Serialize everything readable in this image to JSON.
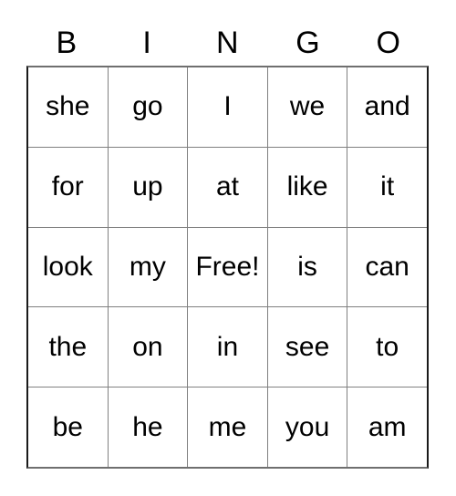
{
  "card": {
    "title": "BINGO",
    "headers": [
      "B",
      "I",
      "N",
      "G",
      "O"
    ],
    "free_space_label": "Free!",
    "free_space_position": {
      "row": 2,
      "col": 2
    },
    "grid": [
      [
        "she",
        "go",
        "I",
        "we",
        "and"
      ],
      [
        "for",
        "up",
        "at",
        "like",
        "it"
      ],
      [
        "look",
        "my",
        "Free!",
        "is",
        "can"
      ],
      [
        "the",
        "on",
        "in",
        "see",
        "to"
      ],
      [
        "be",
        "he",
        "me",
        "you",
        "am"
      ]
    ],
    "colors": {
      "text": "#000000",
      "cell_background": "#ffffff",
      "inner_border": "#808080",
      "outer_border": "#1a1a1a",
      "page_background": "#ffffff"
    }
  }
}
